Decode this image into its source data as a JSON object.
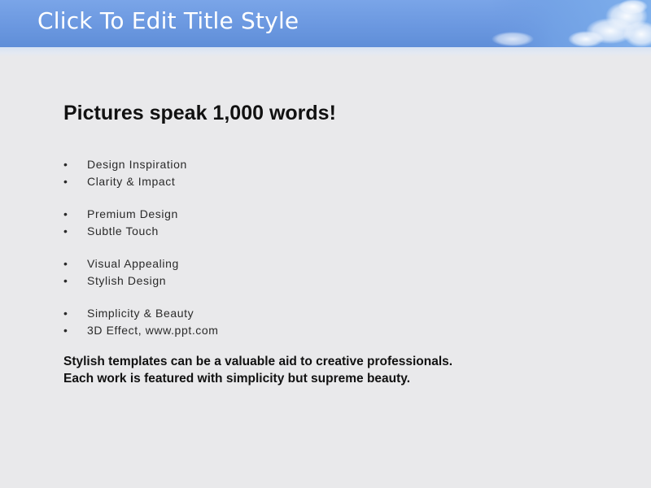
{
  "slide": {
    "title": "Click To Edit Title Style",
    "heading": "Pictures speak 1,000 words!",
    "bullet_groups": [
      [
        "Design Inspiration",
        "Clarity & Impact"
      ],
      [
        "Premium Design",
        "Subtle Touch"
      ],
      [
        "Visual Appealing",
        "Stylish Design"
      ],
      [
        "Simplicity & Beauty",
        "3D Effect, www.ppt.com"
      ]
    ],
    "bullet_glyph": "•",
    "body_lines": [
      "Stylish templates can be a valuable aid to creative professionals.",
      "Each work is featured with simplicity but supreme beauty."
    ]
  },
  "colors": {
    "title_bar": "#6b98e0",
    "background": "#e9e9eb",
    "title_text": "#ffffff",
    "body_text": "#111111"
  }
}
